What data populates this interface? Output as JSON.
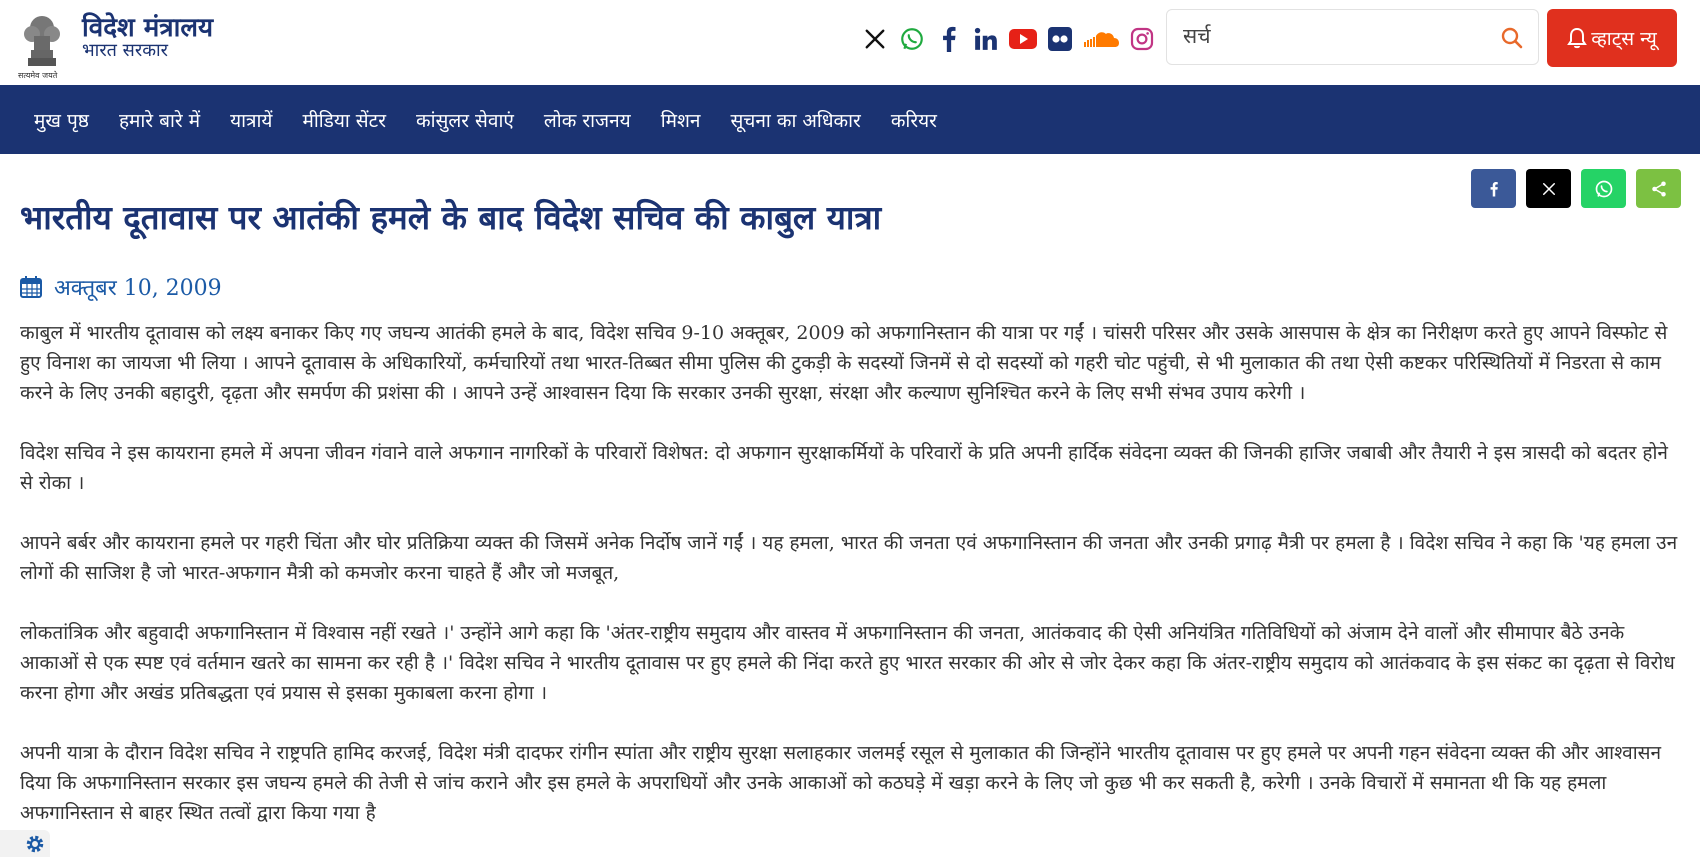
{
  "header": {
    "brand_title": "विदेश मंत्रालय",
    "brand_subtitle": "भारत सरकार",
    "motto": "सत्यमेव जयते",
    "emblem_icon": "national-emblem-icon",
    "social_icons": [
      "x-icon",
      "whatsapp-icon",
      "facebook-icon",
      "linkedin-icon",
      "youtube-icon",
      "flickr-icon",
      "soundcloud-icon",
      "instagram-icon"
    ],
    "search": {
      "placeholder": "सर्च",
      "value": ""
    },
    "news_button_label": "व्हाट्स न्यू"
  },
  "nav": {
    "items": [
      "मुख पृष्ठ",
      "हमारे बारे में",
      "यात्रायें",
      "मीडिया सेंटर",
      "कांसुलर सेवाएं",
      "लोक राजनय",
      "मिशन",
      "सूचना का अधिकार",
      "करियर"
    ]
  },
  "share": {
    "buttons": [
      "facebook-icon",
      "x-icon",
      "whatsapp-icon",
      "share-icon"
    ],
    "colors": {
      "facebook": "#3b5998",
      "x": "#000000",
      "whatsapp": "#25d366",
      "share": "#7cc142"
    }
  },
  "article": {
    "title": "भारतीय दूतावास पर आतंकी हमले के बाद विदेश सचिव की काबुल यात्रा",
    "date": "अक्तूबर 10, 2009",
    "paragraphs": [
      "काबुल में भारतीय दूतावास को लक्ष्य बनाकर किए गए जघन्य आतंकी हमले के बाद, विदेश सचिव 9-10 अक्तूबर, 2009 को अफगानिस्तान की यात्रा पर गईं । चांसरी परिसर और उसके आसपास के क्षेत्र का निरीक्षण करते हुए आपने विस्फोट से हुए विनाश का जायजा भी लिया । आपने दूतावास के अधिकारियों, कर्मचारियों तथा भारत-तिब्बत सीमा पुलिस की टुकड़ी के सदस्यों जिनमें से दो सदस्यों को गहरी चोट पहुंची, से भी मुलाकात की तथा ऐसी कष्टकर परिस्थितियों में निडरता से काम करने के लिए उनकी बहादुरी, दृढ़ता और समर्पण की प्रशंसा की । आपने उन्हें आश्वासन दिया कि सरकार उनकी सुरक्षा, संरक्षा और कल्याण सुनिश्चित करने के लिए सभी संभव उपाय करेगी ।",
      "विदेश सचिव ने इस कायराना हमले में अपना जीवन गंवाने वाले अफगान नागरिकों के परिवारों विशेषत: दो अफगान सुरक्षाकर्मियों के परिवारों के प्रति अपनी हार्दिक संवेदना व्यक्त की जिनकी हाजिर जबाबी और तैयारी ने इस त्रासदी को बदतर होने से रोका ।",
      "आपने बर्बर और कायराना हमले पर गहरी चिंता और घोर प्रतिक्रिया व्यक्त की जिसमें अनेक निर्दोष जानें गईं । यह हमला, भारत की जनता एवं अफगानिस्तान की जनता और उनकी प्रगाढ़ मैत्री पर हमला है । विदेश सचिव ने कहा कि 'यह हमला उन लोगों की साजिश है जो भारत-अफगान मैत्री को कमजोर करना चाहते हैं और जो मजबूत,",
      "लोकतांत्रिक और बहुवादी अफगानिस्तान में विश्वास नहीं रखते ।' उन्होंने आगे कहा कि 'अंतर-राष्ट्रीय समुदाय और वास्तव में अफगानिस्तान की जनता, आतंकवाद की ऐसी अनियंत्रित गतिविधियों को अंजाम देने वालों और सीमापार बैठे उनके आकाओं से एक स्पष्ट एवं वर्तमान खतरे का सामना कर रही है ।' विदेश सचिव ने भारतीय दूतावास पर हुए हमले की निंदा करते हुए भारत सरकार की ओर से जोर देकर कहा कि अंतर-राष्ट्रीय समुदाय को आतंकवाद के इस संकट का दृढ़ता से विरोध करना होगा और अखंड प्रतिबद्धता एवं प्रयास से इसका मुकाबला करना होगा ।",
      "अपनी यात्रा के दौरान विदेश सचिव ने राष्ट्रपति हामिद करजई, विदेश मंत्री दादफर रांगीन स्पांता और राष्ट्रीय सुरक्षा सलाहकार जलमई रसूल से मुलाकात की जिन्होंने भारतीय दूतावास पर हुए हमले पर अपनी गहन संवेदना व्यक्त की और आश्वासन दिया कि अफगानिस्तान सरकार इस जघन्य हमले की तेजी से जांच कराने और इस हमले के अपराधियों और उनके आकाओं को कठघड़े में खड़ा करने के लिए जो कुछ भी कर सकती है, करेगी । उनके विचारों में समानता थी कि यह हमला अफगानिस्तान से बाहर स्थित तत्वों द्वारा किया गया है"
    ]
  },
  "accessibility_icon": "gear-icon"
}
